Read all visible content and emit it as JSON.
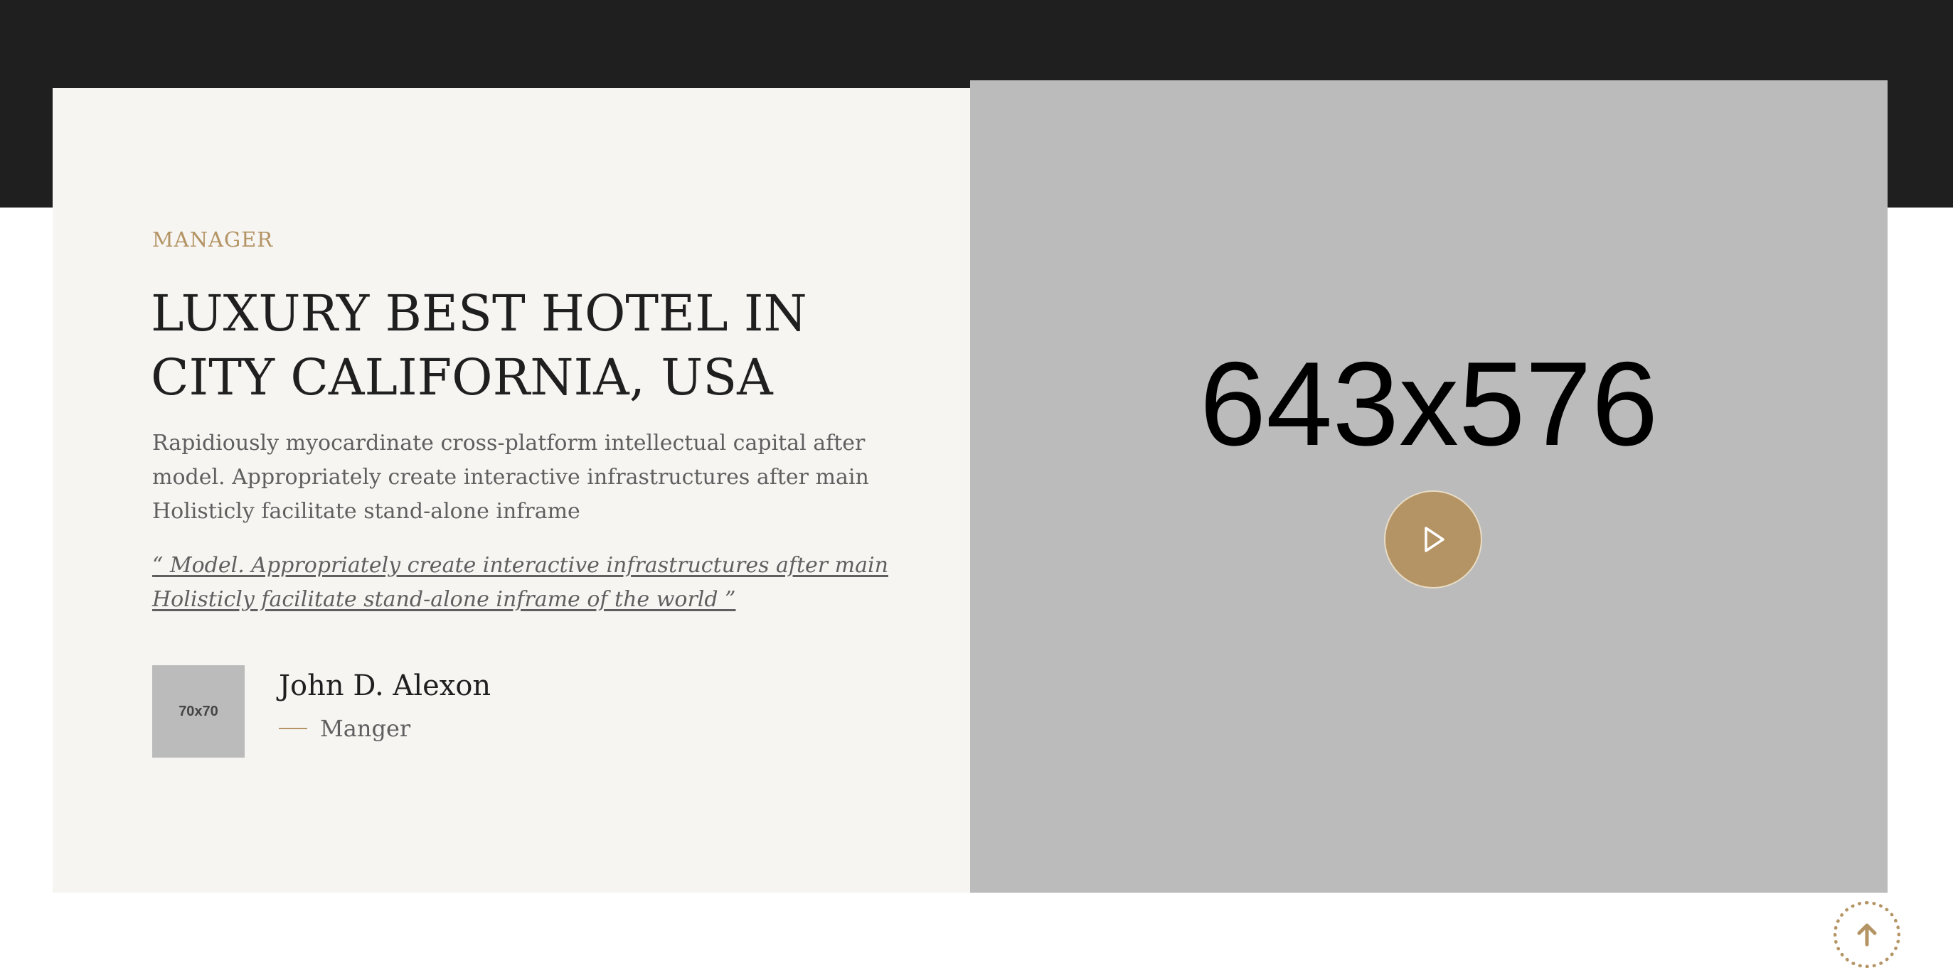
{
  "section": {
    "eyebrow": "MANAGER",
    "headline_lines": [
      "LUXURY BEST HOTEL IN",
      "CITY CALIFORNIA, USA"
    ],
    "body": "Rapidiously myocardinate cross-platform intellectual capital after model. Appropriately create interactive infrastructures after main Holisticly facilitate stand-alone inframe",
    "quote_lines": [
      "“ Model. Appropriately create interactive infrastructures after main",
      "Holisticly facilitate stand-alone inframe of the world ”"
    ]
  },
  "author": {
    "avatar_label": "70x70",
    "name": "John D. Alexon",
    "role": "Manger"
  },
  "media": {
    "placeholder_label": "643x576",
    "play_icon": "play-icon"
  },
  "controls": {
    "back_to_top_icon": "arrow-up-icon"
  },
  "colors": {
    "accent": "#b49464",
    "dark": "#1f1f1f",
    "panel": "#f6f5f2",
    "placeholder": "#bbbbbb"
  }
}
